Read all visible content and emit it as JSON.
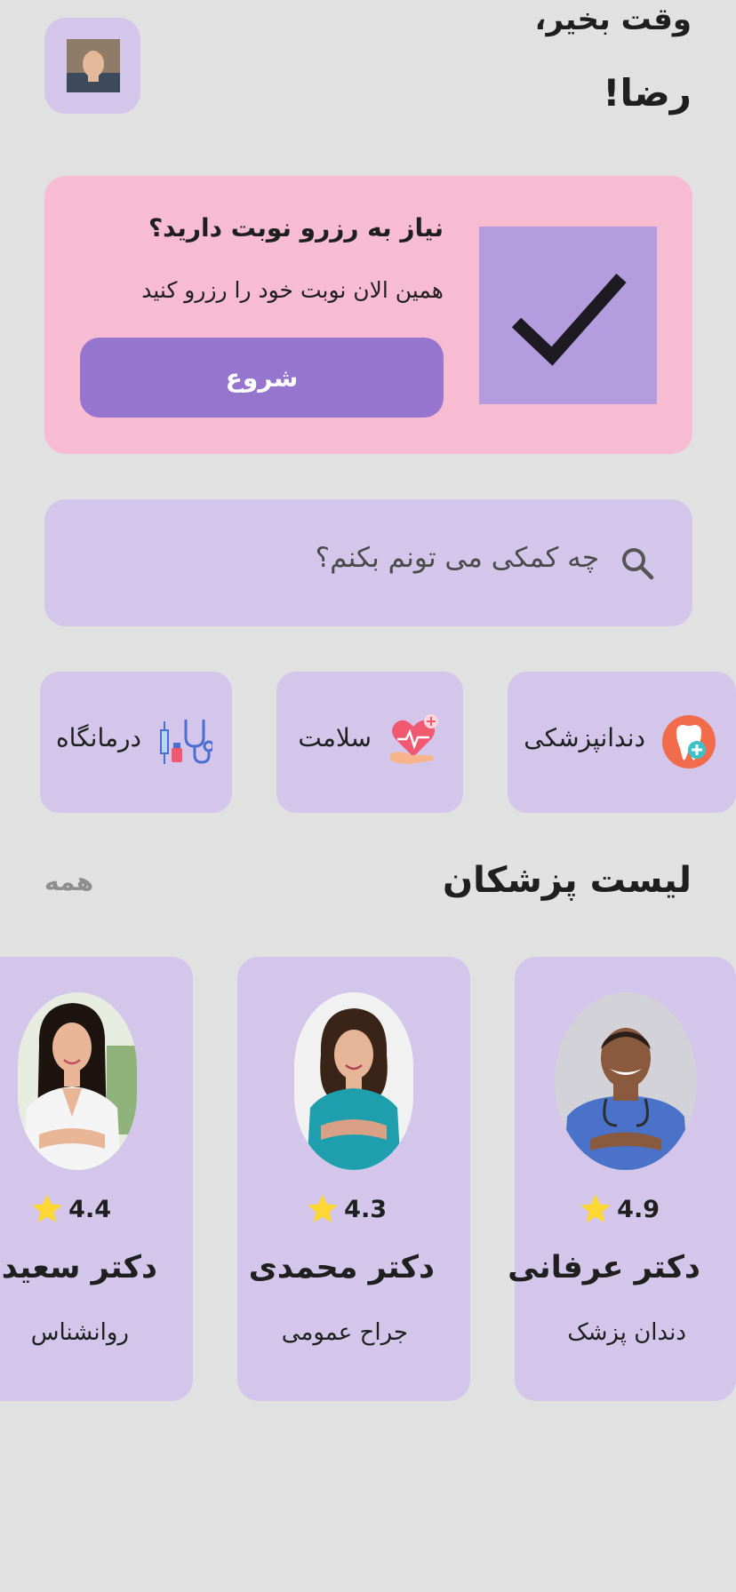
{
  "header": {
    "greeting": "وقت بخیر،",
    "user_name": "رضا!"
  },
  "promo": {
    "title": "نیاز به رزرو نوبت دارید؟",
    "subtitle": "همین الان نوبت خود را رزرو کنید",
    "button_label": "شروع"
  },
  "search": {
    "placeholder": "چه کمکی می تونم بکنم؟"
  },
  "categories": [
    {
      "label": "دندانپزشکی",
      "icon": "tooth-icon"
    },
    {
      "label": "سلامت",
      "icon": "heart-care-icon"
    },
    {
      "label": "درمانگاه",
      "icon": "stethoscope-icon"
    }
  ],
  "doctors_section": {
    "title": "لیست پزشکان",
    "see_all": "همه"
  },
  "doctors": [
    {
      "name": "دکتر عرفانی",
      "specialty": "دندان پزشک",
      "rating": "4.9"
    },
    {
      "name": "دکتر محمدی",
      "specialty": "جراح عمومی",
      "rating": "4.3"
    },
    {
      "name": "دکتر سعیدی",
      "specialty": "روانشناس",
      "rating": "4.4"
    }
  ],
  "colors": {
    "background": "#e1e1e1",
    "card": "#d3c6ea",
    "promo": "#f8bcd2",
    "accent": "#9675cf",
    "check_box": "#b39ddf",
    "star": "#fdd835"
  }
}
